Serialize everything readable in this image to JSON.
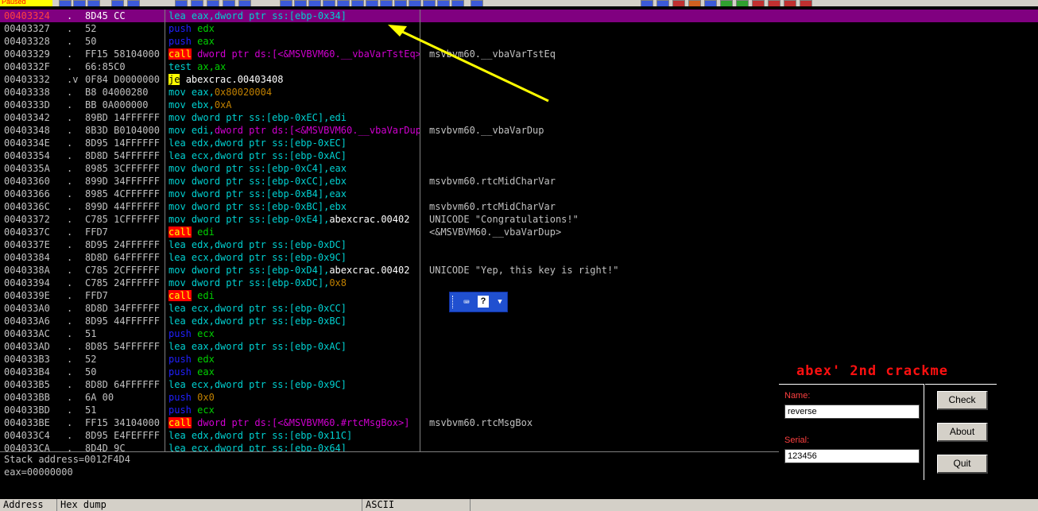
{
  "toolbar": {
    "status": "Paused"
  },
  "disasm": {
    "rows": [
      {
        "addr": "00403324",
        "mark": ".",
        "hex": "8D45 CC",
        "mn": "lea",
        "mnc": "",
        "ops": [
          [
            "eax,dword ptr ss:[ebp-0x34]",
            "mem"
          ]
        ],
        "cmt": ""
      },
      {
        "addr": "00403327",
        "mark": ".",
        "hex": "52",
        "mn": "push",
        "mnc": "push",
        "ops": [
          [
            "edx",
            "reg"
          ]
        ],
        "cmt": ""
      },
      {
        "addr": "00403328",
        "mark": ".",
        "hex": "50",
        "mn": "push",
        "mnc": "push",
        "ops": [
          [
            "eax",
            "reg"
          ]
        ],
        "cmt": ""
      },
      {
        "addr": "00403329",
        "mark": ".",
        "hex": "FF15 58104000",
        "mn": "call",
        "mnc": "call",
        "ops": [
          [
            "dword ptr ds:[<&MSVBVM60.__vbaVarTstEq>]",
            "import"
          ]
        ],
        "cmt": "msvbvm60.__vbaVarTstEq"
      },
      {
        "addr": "0040332F",
        "mark": ".",
        "hex": "66:85C0",
        "mn": "test",
        "mnc": "",
        "ops": [
          [
            "ax,ax",
            "reg"
          ]
        ],
        "cmt": ""
      },
      {
        "addr": "00403332",
        "mark": ".v",
        "hex": "0F84 D0000000",
        "mn": "je",
        "mnc": "je",
        "ops": [
          [
            "abexcrac.00403408",
            "plain"
          ]
        ],
        "cmt": ""
      },
      {
        "addr": "00403338",
        "mark": ".",
        "hex": "B8 04000280",
        "mn": "mov",
        "mnc": "",
        "ops": [
          [
            "eax,",
            "op"
          ],
          [
            "0x80020004",
            "imm"
          ]
        ],
        "cmt": ""
      },
      {
        "addr": "0040333D",
        "mark": ".",
        "hex": "BB 0A000000",
        "mn": "mov",
        "mnc": "",
        "ops": [
          [
            "ebx,",
            "op"
          ],
          [
            "0xA",
            "imm"
          ]
        ],
        "cmt": ""
      },
      {
        "addr": "00403342",
        "mark": ".",
        "hex": "89BD 14FFFFFF",
        "mn": "mov",
        "mnc": "",
        "ops": [
          [
            "dword ptr ss:[ebp-0xEC],edi",
            "mem"
          ]
        ],
        "cmt": ""
      },
      {
        "addr": "00403348",
        "mark": ".",
        "hex": "8B3D B0104000",
        "mn": "mov",
        "mnc": "",
        "ops": [
          [
            "edi,",
            "op"
          ],
          [
            "dword ptr ds:[<&MSVBVM60.__vbaVarDup>]",
            "import"
          ]
        ],
        "cmt": "msvbvm60.__vbaVarDup"
      },
      {
        "addr": "0040334E",
        "mark": ".",
        "hex": "8D95 14FFFFFF",
        "mn": "lea",
        "mnc": "",
        "ops": [
          [
            "edx,dword ptr ss:[ebp-0xEC]",
            "mem"
          ]
        ],
        "cmt": ""
      },
      {
        "addr": "00403354",
        "mark": ".",
        "hex": "8D8D 54FFFFFF",
        "mn": "lea",
        "mnc": "",
        "ops": [
          [
            "ecx,dword ptr ss:[ebp-0xAC]",
            "mem"
          ]
        ],
        "cmt": ""
      },
      {
        "addr": "0040335A",
        "mark": ".",
        "hex": "8985 3CFFFFFF",
        "mn": "mov",
        "mnc": "",
        "ops": [
          [
            "dword ptr ss:[ebp-0xC4],eax",
            "mem"
          ]
        ],
        "cmt": ""
      },
      {
        "addr": "00403360",
        "mark": ".",
        "hex": "899D 34FFFFFF",
        "mn": "mov",
        "mnc": "",
        "ops": [
          [
            "dword ptr ss:[ebp-0xCC],ebx",
            "mem"
          ]
        ],
        "cmt": "msvbvm60.rtcMidCharVar"
      },
      {
        "addr": "00403366",
        "mark": ".",
        "hex": "8985 4CFFFFFF",
        "mn": "mov",
        "mnc": "",
        "ops": [
          [
            "dword ptr ss:[ebp-0xB4],eax",
            "mem"
          ]
        ],
        "cmt": ""
      },
      {
        "addr": "0040336C",
        "mark": ".",
        "hex": "899D 44FFFFFF",
        "mn": "mov",
        "mnc": "",
        "ops": [
          [
            "dword ptr ss:[ebp-0xBC],ebx",
            "mem"
          ]
        ],
        "cmt": "msvbvm60.rtcMidCharVar"
      },
      {
        "addr": "00403372",
        "mark": ".",
        "hex": "C785 1CFFFFFF",
        "mn": "mov",
        "mnc": "",
        "ops": [
          [
            "dword ptr ss:[ebp-0xE4],",
            "mem"
          ],
          [
            "abexcrac.00402",
            "plain"
          ]
        ],
        "cmt": "UNICODE \"Congratulations!\""
      },
      {
        "addr": "0040337C",
        "mark": ".",
        "hex": "FFD7",
        "mn": "call",
        "mnc": "call",
        "ops": [
          [
            "edi",
            "reg"
          ]
        ],
        "cmt": "<&MSVBVM60.__vbaVarDup>"
      },
      {
        "addr": "0040337E",
        "mark": ".",
        "hex": "8D95 24FFFFFF",
        "mn": "lea",
        "mnc": "",
        "ops": [
          [
            "edx,dword ptr ss:[ebp-0xDC]",
            "mem"
          ]
        ],
        "cmt": ""
      },
      {
        "addr": "00403384",
        "mark": ".",
        "hex": "8D8D 64FFFFFF",
        "mn": "lea",
        "mnc": "",
        "ops": [
          [
            "ecx,dword ptr ss:[ebp-0x9C]",
            "mem"
          ]
        ],
        "cmt": ""
      },
      {
        "addr": "0040338A",
        "mark": ".",
        "hex": "C785 2CFFFFFF",
        "mn": "mov",
        "mnc": "",
        "ops": [
          [
            "dword ptr ss:[ebp-0xD4],",
            "mem"
          ],
          [
            "abexcrac.00402",
            "plain"
          ]
        ],
        "cmt": "UNICODE \"Yep, this key is right!\""
      },
      {
        "addr": "00403394",
        "mark": ".",
        "hex": "C785 24FFFFFF",
        "mn": "mov",
        "mnc": "",
        "ops": [
          [
            "dword ptr ss:[ebp-0xDC],",
            "mem"
          ],
          [
            "0x8",
            "imm"
          ]
        ],
        "cmt": ""
      },
      {
        "addr": "0040339E",
        "mark": ".",
        "hex": "FFD7",
        "mn": "call",
        "mnc": "call",
        "ops": [
          [
            "edi",
            "reg"
          ]
        ],
        "cmt": ""
      },
      {
        "addr": "004033A0",
        "mark": ".",
        "hex": "8D8D 34FFFFFF",
        "mn": "lea",
        "mnc": "",
        "ops": [
          [
            "ecx,dword ptr ss:[ebp-0xCC]",
            "mem"
          ]
        ],
        "cmt": ""
      },
      {
        "addr": "004033A6",
        "mark": ".",
        "hex": "8D95 44FFFFFF",
        "mn": "lea",
        "mnc": "",
        "ops": [
          [
            "edx,dword ptr ss:[ebp-0xBC]",
            "mem"
          ]
        ],
        "cmt": ""
      },
      {
        "addr": "004033AC",
        "mark": ".",
        "hex": "51",
        "mn": "push",
        "mnc": "push",
        "ops": [
          [
            "ecx",
            "reg"
          ]
        ],
        "cmt": ""
      },
      {
        "addr": "004033AD",
        "mark": ".",
        "hex": "8D85 54FFFFFF",
        "mn": "lea",
        "mnc": "",
        "ops": [
          [
            "eax,dword ptr ss:[ebp-0xAC]",
            "mem"
          ]
        ],
        "cmt": ""
      },
      {
        "addr": "004033B3",
        "mark": ".",
        "hex": "52",
        "mn": "push",
        "mnc": "push",
        "ops": [
          [
            "edx",
            "reg"
          ]
        ],
        "cmt": ""
      },
      {
        "addr": "004033B4",
        "mark": ".",
        "hex": "50",
        "mn": "push",
        "mnc": "push",
        "ops": [
          [
            "eax",
            "reg"
          ]
        ],
        "cmt": ""
      },
      {
        "addr": "004033B5",
        "mark": ".",
        "hex": "8D8D 64FFFFFF",
        "mn": "lea",
        "mnc": "",
        "ops": [
          [
            "ecx,dword ptr ss:[ebp-0x9C]",
            "mem"
          ]
        ],
        "cmt": ""
      },
      {
        "addr": "004033BB",
        "mark": ".",
        "hex": "6A 00",
        "mn": "push",
        "mnc": "push",
        "ops": [
          [
            "0x0",
            "imm"
          ]
        ],
        "cmt": ""
      },
      {
        "addr": "004033BD",
        "mark": ".",
        "hex": "51",
        "mn": "push",
        "mnc": "push",
        "ops": [
          [
            "ecx",
            "reg"
          ]
        ],
        "cmt": ""
      },
      {
        "addr": "004033BE",
        "mark": ".",
        "hex": "FF15 34104000",
        "mn": "call",
        "mnc": "call",
        "ops": [
          [
            "dword ptr ds:[<&MSVBVM60.#rtcMsgBox>]",
            "import"
          ]
        ],
        "cmt": "msvbvm60.rtcMsgBox"
      },
      {
        "addr": "004033C4",
        "mark": ".",
        "hex": "8D95 E4FEFFFF",
        "mn": "lea",
        "mnc": "",
        "ops": [
          [
            "edx,dword ptr ss:[ebp-0x11C]",
            "mem"
          ]
        ],
        "cmt": ""
      },
      {
        "addr": "004033CA",
        "mark": ".",
        "hex": "8D4D 9C",
        "mn": "lea",
        "mnc": "",
        "ops": [
          [
            "ecx,dword ptr ss:[ebp-0x64]",
            "mem"
          ]
        ],
        "cmt": ""
      }
    ]
  },
  "info": {
    "stack_address": "Stack address=0012F4D4",
    "eax": "eax=00000000"
  },
  "dump": {
    "col_address": "Address",
    "col_hexdump": "Hex dump",
    "col_ascii": "ASCII"
  },
  "floating_toolbar": {
    "keyboard_icon": "keyboard-icon",
    "help_icon": "help-icon",
    "help_glyph": "?"
  },
  "crackme": {
    "title": "abex' 2nd crackme",
    "name_label": "Name:",
    "name_value": "reverse",
    "serial_label": "Serial:",
    "serial_value": "123456",
    "check_label": "Check",
    "about_label": "About",
    "quit_label": "Quit"
  },
  "colors": {
    "selection": "#800080",
    "annotation_arrow": "#ffff00",
    "crackme_title": "#ff1010"
  }
}
